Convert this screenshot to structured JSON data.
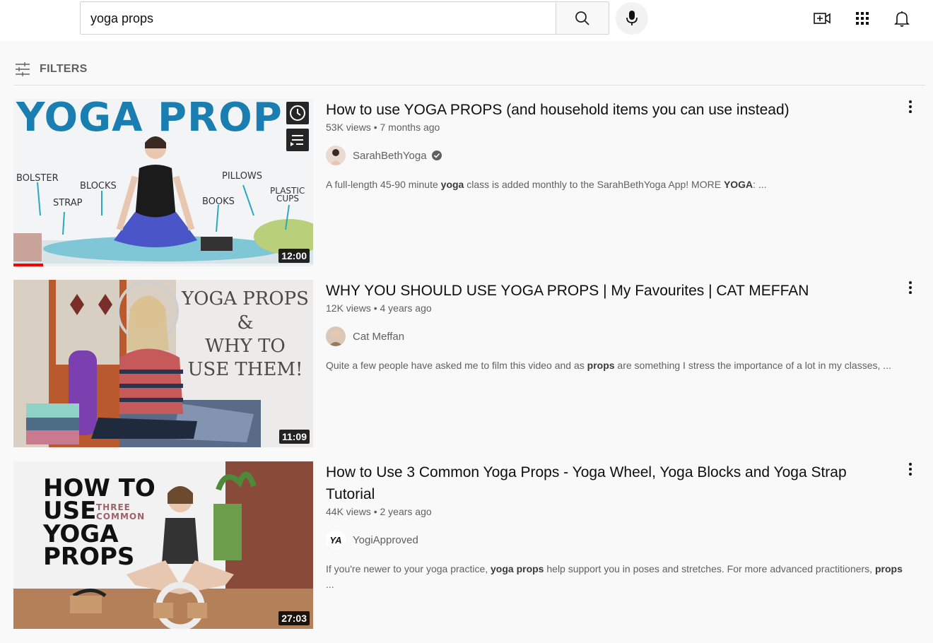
{
  "search": {
    "query": "yoga props"
  },
  "icons": {
    "clear": "close-icon",
    "search": "search-icon",
    "mic": "mic-icon",
    "create": "video-add-icon",
    "apps": "apps-grid-icon",
    "notifications": "bell-icon",
    "filters": "sliders-icon",
    "more": "more-vert-icon"
  },
  "filters": {
    "label": "FILTERS"
  },
  "results": [
    {
      "title": "How to use YOGA PROPS (and household items you can use instead)",
      "views": "53K views",
      "age": "7 months ago",
      "channel": "SarahBethYoga",
      "verified": true,
      "duration": "12:00",
      "watched_fraction": 0.1,
      "desc_parts": [
        "A full-length 45-90 minute ",
        "yoga",
        " class is added monthly to the SarahBethYoga App! MORE ",
        "YOGA",
        ": ..."
      ],
      "thumb_text": {
        "headline": "YOGA PROP",
        "labels": [
          "BOLSTER",
          "BLOCKS",
          "STRAP",
          "PILLOWS",
          "BOOKS",
          "PLASTIC",
          "CUPS"
        ]
      }
    },
    {
      "title": "WHY YOU SHOULD USE YOGA PROPS | My Favourites | CAT MEFFAN",
      "views": "12K views",
      "age": "4 years ago",
      "channel": "Cat Meffan",
      "verified": false,
      "duration": "11:09",
      "desc_parts": [
        "Quite a few people have asked me to film this video and as ",
        "props",
        " are something I stress the importance of a lot in my classes, ..."
      ],
      "thumb_text": {
        "lines": [
          "YOGA PROPS",
          "&",
          "WHY TO",
          "USE THEM!"
        ]
      }
    },
    {
      "title": "How to Use 3 Common Yoga Props - Yoga Wheel, Yoga Blocks and Yoga Strap Tutorial",
      "views": "44K views",
      "age": "2 years ago",
      "channel": "YogiApproved",
      "channel_avatar_text": "YA",
      "verified": false,
      "duration": "27:03",
      "desc_parts": [
        "If you're newer to your yoga practice, ",
        "yoga props",
        " help support you in poses and stretches. For more advanced practitioners, ",
        "props",
        " ..."
      ],
      "thumb_text": {
        "lines": [
          "HOW TO",
          "USE",
          "YOGA",
          "PROPS"
        ],
        "small": [
          "THREE",
          "COMMON"
        ]
      }
    }
  ],
  "colors": {
    "accent_red": "#ff0000",
    "thumb1_blue": "#1a7fb0",
    "text_secondary": "#606060"
  }
}
